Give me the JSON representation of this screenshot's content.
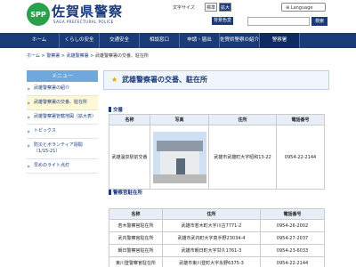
{
  "header": {
    "logo_mark": "SPP",
    "logo_title": "佐賀県警察",
    "logo_sub": "SAGA PREFECTURAL POLICE",
    "text_size_label": "文字サイズ",
    "text_size_std": "標準",
    "text_size_large": "拡大",
    "language": "Language",
    "color_button": "背景色変更",
    "search_placeholder": "",
    "search_button": "検索"
  },
  "nav": {
    "items": [
      "ホーム",
      "くらしの安全",
      "交通安全",
      "相談窓口",
      "申請・届出",
      "佐賀県警察の紹介",
      "警察署"
    ],
    "active_index": 6
  },
  "breadcrumb": {
    "home": "ホーム",
    "sep1": " > ",
    "level1": "警察署",
    "sep2": " > ",
    "level2": "武雄警察署",
    "sep3": " > ",
    "current": "武雄警察署の交番、駐在所"
  },
  "side_menu": {
    "heading": "メニュー",
    "items": [
      "武雄警察署の紹介",
      "武雄警察署の交番、駐在所",
      "武雄警察署管轄地図（拡大表）",
      "トピックス",
      "防災とボランティア週間（1/15-21）",
      "早めのライト点灯"
    ],
    "active_index": 1
  },
  "main": {
    "title": "武雄警察署の交番、駐在所",
    "koban": {
      "heading": "交番",
      "columns": [
        "名称",
        "写真",
        "住所",
        "電話番号"
      ],
      "row": {
        "name": "武雄温泉駅前交番",
        "address": "武雄市武雄町大字昭和13-22",
        "phone": "0954-22-2144"
      }
    },
    "chuzaisho": {
      "heading": "警察官駐在所",
      "columns": [
        "名称",
        "住所",
        "電話番号"
      ],
      "rows": [
        {
          "name": "若木警察官駐在所",
          "address": "武雄市若木町大字川古7771-2",
          "phone": "0954-26-2002"
        },
        {
          "name": "武内警察官駐在所",
          "address": "武雄市武内町大字真手野23034-4",
          "phone": "0954-27-2037"
        },
        {
          "name": "朝日警察官駐在所",
          "address": "武雄市朝日町大字甘久1761-3",
          "phone": "0954-23-6033"
        },
        {
          "name": "東川登警察官駐在所",
          "address": "武雄市東川登町大字永野6375-3",
          "phone": "0954-22-2144"
        }
      ]
    }
  },
  "colors": {
    "brand": "#1a3a7a",
    "side_head": "#6fa8dc",
    "logo": "#2aa04a",
    "title_star": "#e8a400"
  }
}
